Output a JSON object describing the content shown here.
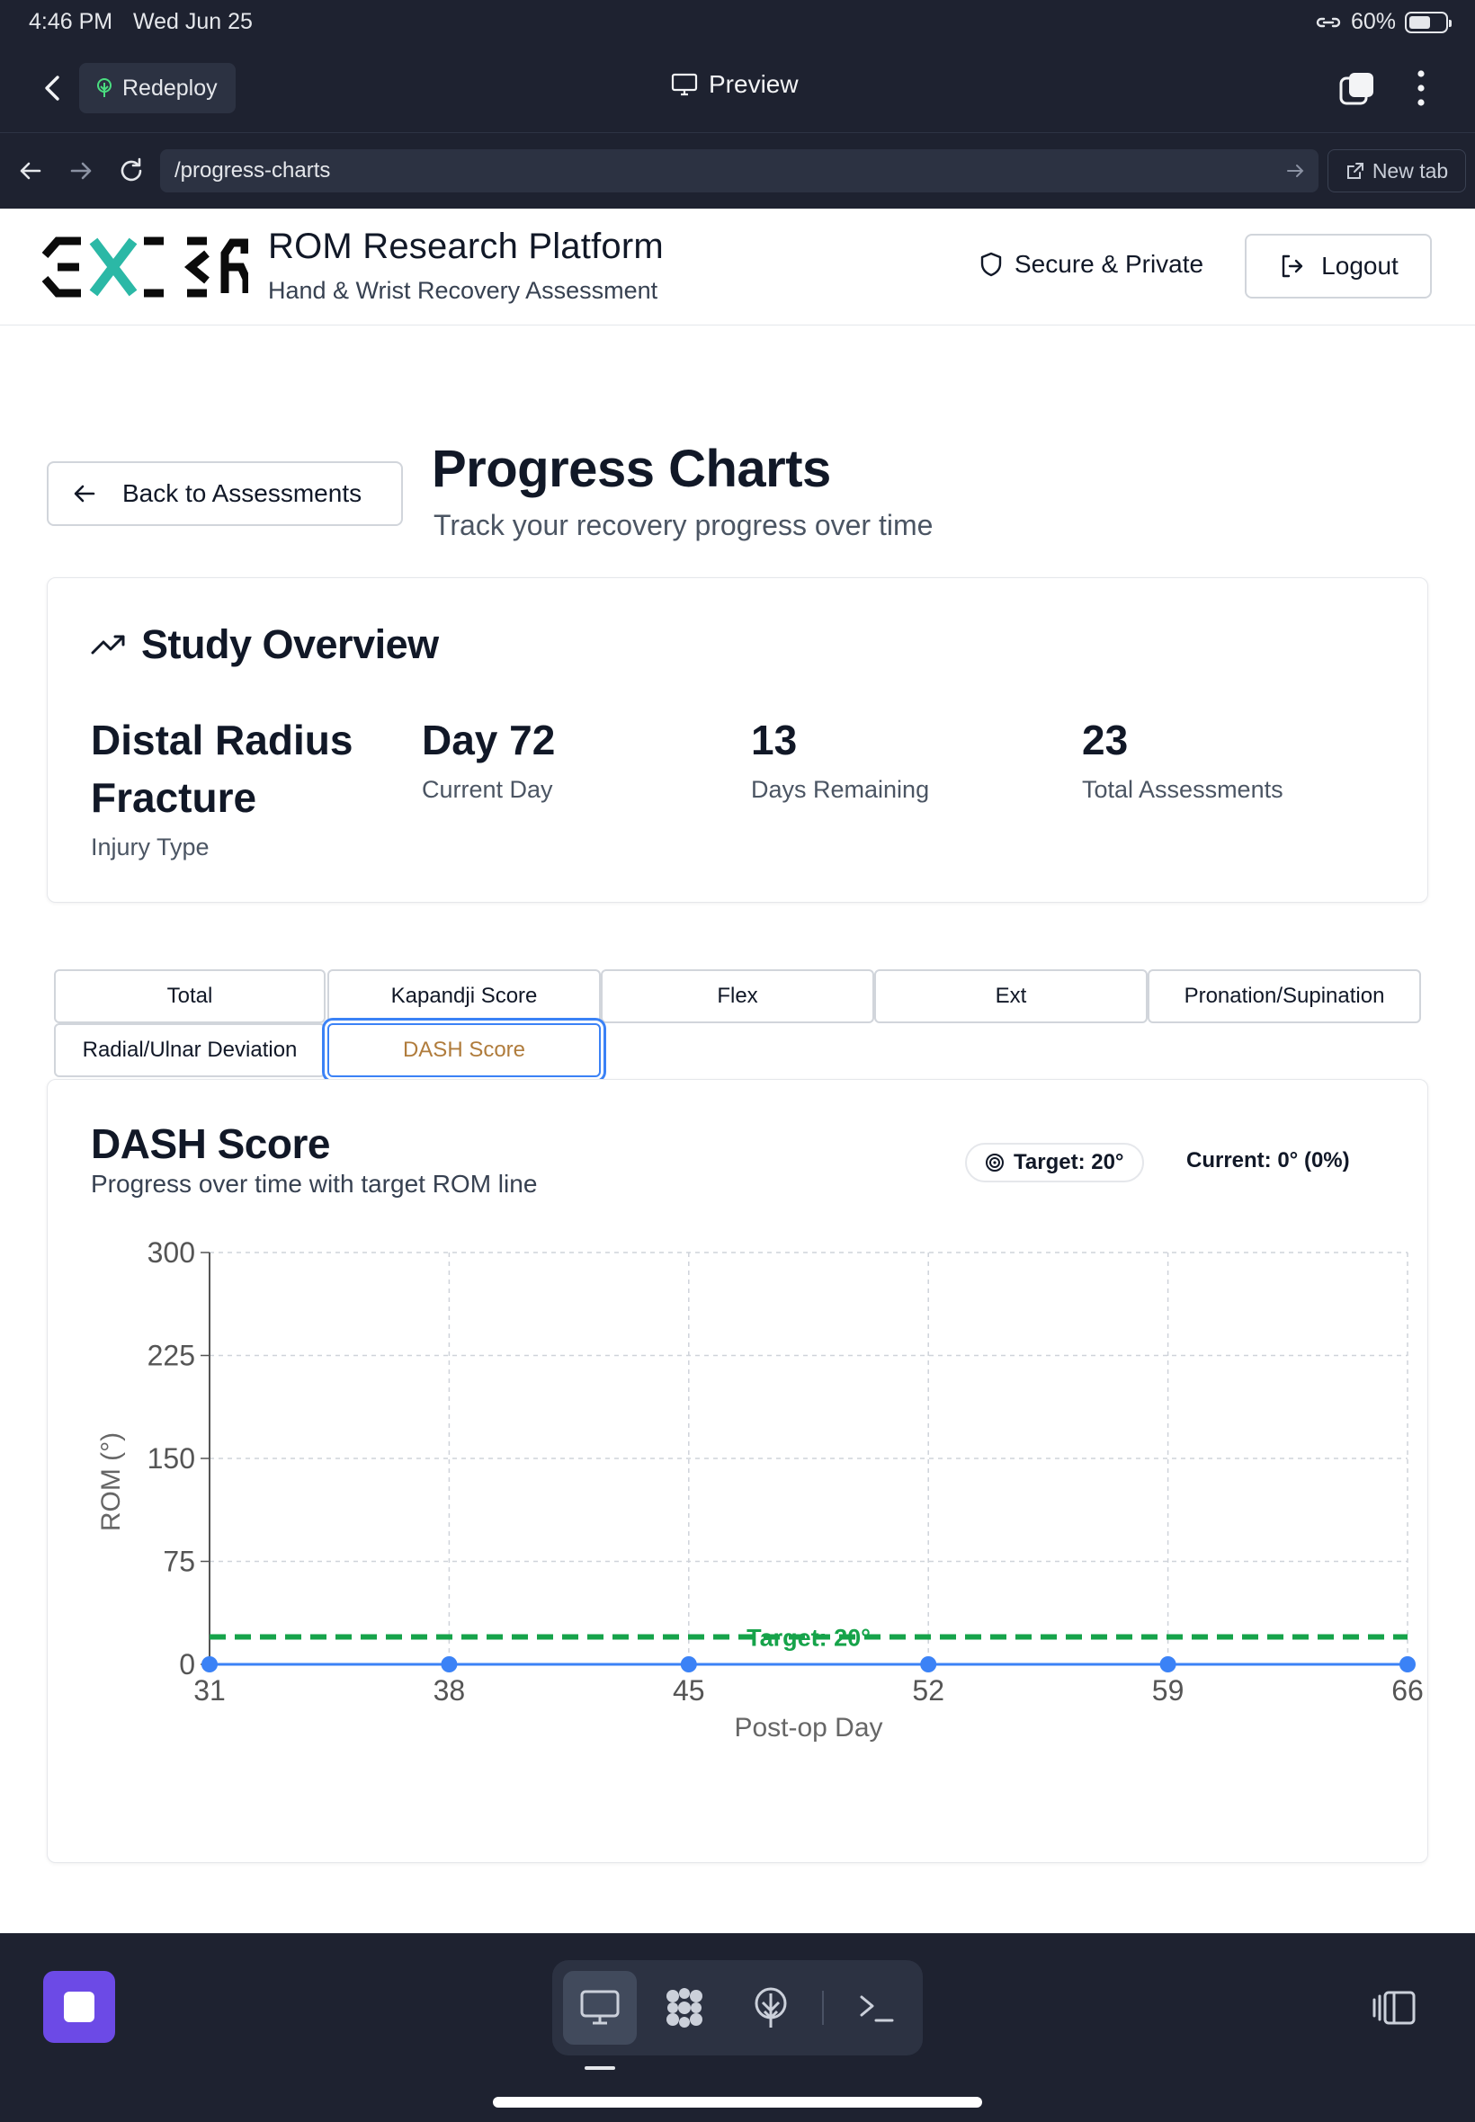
{
  "status_bar": {
    "time": "4:46 PM",
    "date": "Wed Jun 25",
    "battery": "60%",
    "battery_level": 0.6
  },
  "app_bar": {
    "redeploy_label": "Redeploy",
    "preview_label": "Preview"
  },
  "url_bar": {
    "url": "/progress-charts",
    "new_tab_label": "New tab"
  },
  "header": {
    "brand_title": "ROM Research Platform",
    "brand_subtitle": "Hand & Wrist Recovery Assessment",
    "secure_label": "Secure & Private",
    "logout_label": "Logout"
  },
  "page": {
    "back_label": "Back to Assessments",
    "title": "Progress Charts",
    "subtitle": "Track your recovery progress over time"
  },
  "overview": {
    "title": "Study Overview",
    "stats": [
      {
        "value_line1": "Distal Radius",
        "value_line2": "Fracture",
        "label": "Injury Type"
      },
      {
        "value": "Day 72",
        "label": "Current Day"
      },
      {
        "value": "13",
        "label": "Days Remaining"
      },
      {
        "value": "23",
        "label": "Total Assessments"
      }
    ]
  },
  "tabs": [
    {
      "label": "Total",
      "active": false
    },
    {
      "label": "Kapandji Score",
      "active": false
    },
    {
      "label": "Flex",
      "active": false
    },
    {
      "label": "Ext",
      "active": false
    },
    {
      "label": "Pronation/Supination",
      "active": false
    },
    {
      "label": "Radial/Ulnar Deviation",
      "active": false
    },
    {
      "label": "DASH Score",
      "active": true
    }
  ],
  "chart_card": {
    "title": "DASH Score",
    "subtitle": "Progress over time with target ROM line",
    "target_label": "Target: 20°",
    "current_label": "Current: 0° (0%)"
  },
  "chart_data": {
    "type": "line",
    "xlabel": "Post-op Day",
    "ylabel": "ROM (°)",
    "x": [
      31,
      38,
      45,
      52,
      59,
      66
    ],
    "xticks": [
      31,
      38,
      45,
      52,
      59,
      66
    ],
    "yticks": [
      0,
      75,
      150,
      225,
      300
    ],
    "ylim": [
      0,
      300
    ],
    "series": [
      {
        "values": [
          0,
          0,
          0,
          0,
          0,
          0
        ],
        "color": "#3b82f6"
      }
    ],
    "target": {
      "value": 20,
      "label": "Target: 20°",
      "color": "#16a34a"
    },
    "grid": true
  },
  "colors": {
    "chrome": "#1e2230",
    "accent": "#3b82f6",
    "target": "#16a34a",
    "stop": "#6c4ae6",
    "active_tab_text": "#b07c3c"
  }
}
